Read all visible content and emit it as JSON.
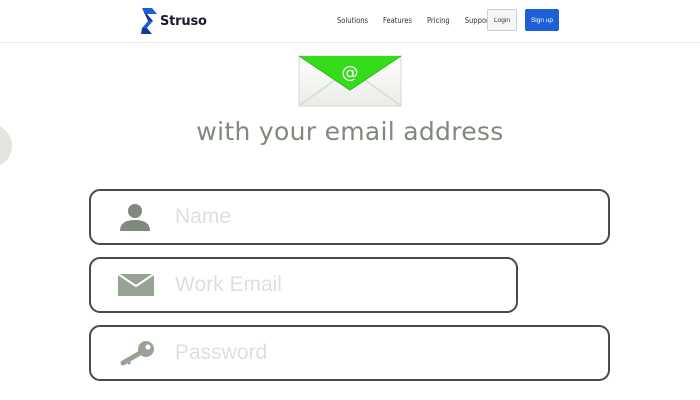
{
  "header": {
    "logo_text": "Struso",
    "nav": [
      "Solutions",
      "Features",
      "Pricing",
      "Support"
    ],
    "login_label": "Login",
    "signup_label": "Sign up",
    "signup_color": "#1d5fd8"
  },
  "main": {
    "envelope_icon": "email-envelope-icon",
    "envelope_accent": "#35dc1b",
    "heading": "with your email address",
    "fields": [
      {
        "icon": "user-icon",
        "placeholder": "Name"
      },
      {
        "icon": "mail-icon",
        "placeholder": "Work Email"
      },
      {
        "icon": "key-icon",
        "placeholder": "Password"
      }
    ]
  }
}
